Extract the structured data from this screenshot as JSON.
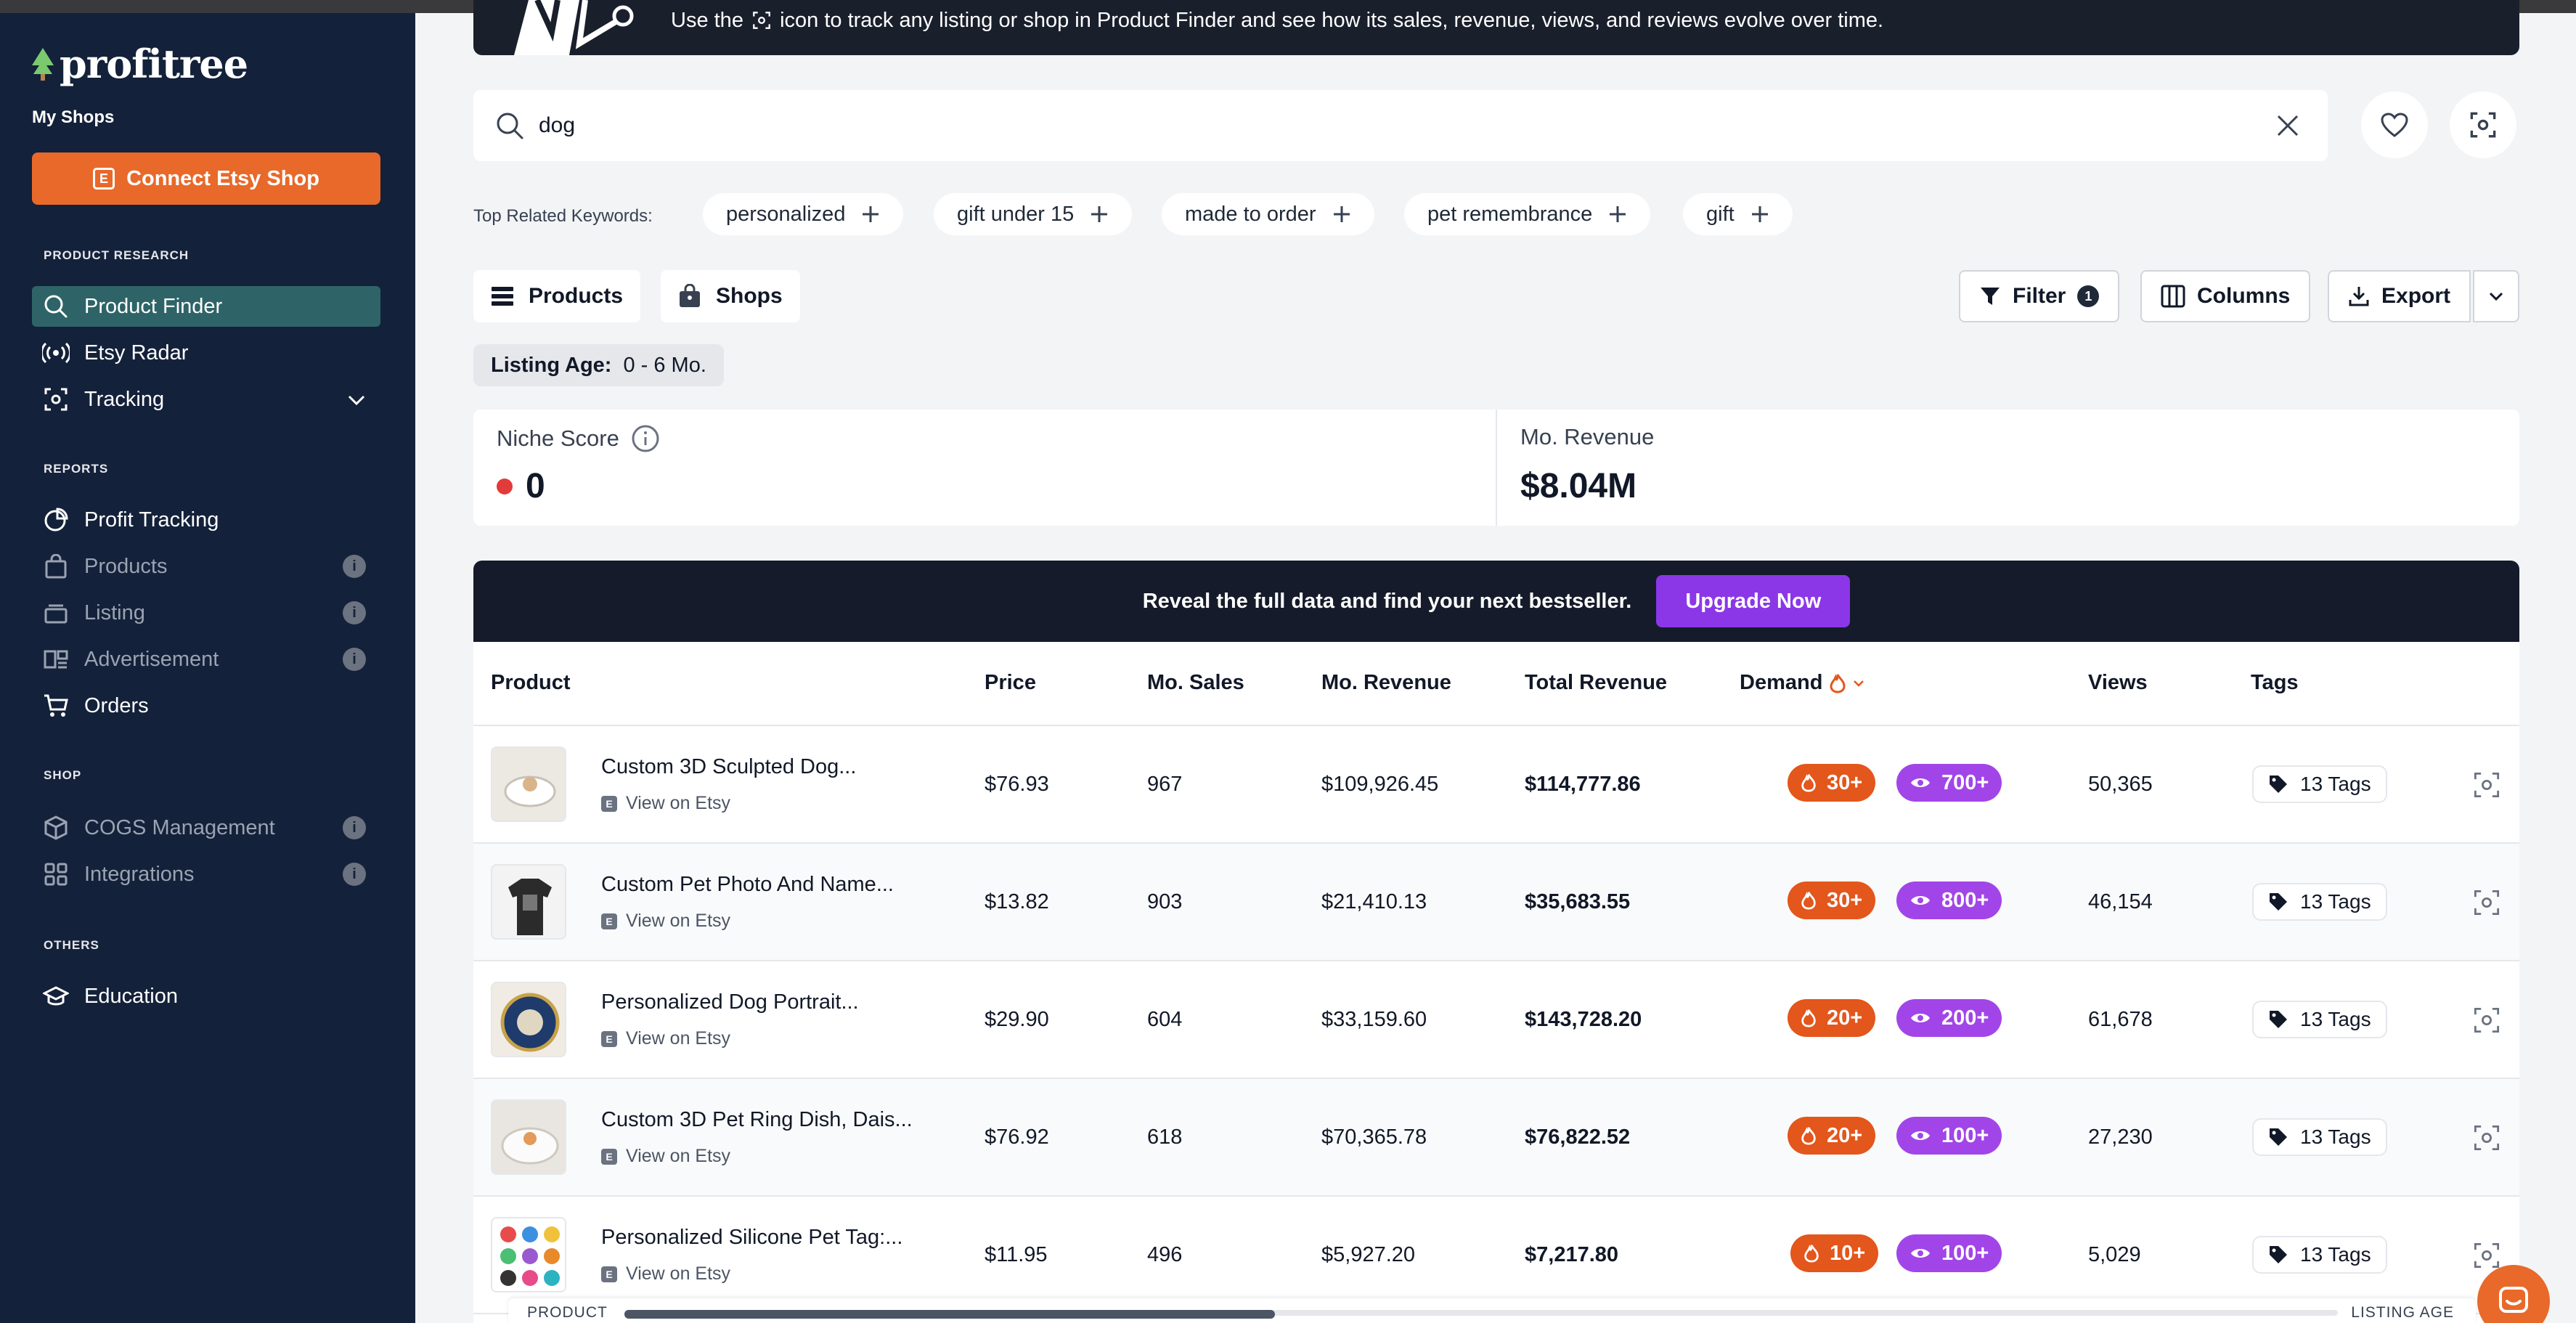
{
  "sidebar": {
    "logo": "profitree",
    "my_shops": "My Shops",
    "connect_button": "Connect Etsy Shop",
    "sections": {
      "product_research": "PRODUCT RESEARCH",
      "reports": "REPORTS",
      "shop": "SHOP",
      "others": "OTHERS"
    },
    "items": {
      "product_finder": "Product Finder",
      "etsy_radar": "Etsy Radar",
      "tracking": "Tracking",
      "profit_tracking": "Profit Tracking",
      "products": "Products",
      "listing": "Listing",
      "advertisement": "Advertisement",
      "orders": "Orders",
      "cogs": "COGS Management",
      "integrations": "Integrations",
      "education": "Education"
    }
  },
  "banner": {
    "text_before": "Use the",
    "text_after": "icon to track any listing or shop in Product Finder and see how its sales, revenue, views, and reviews evolve over time."
  },
  "search": {
    "value": "dog"
  },
  "keywords": {
    "label": "Top Related Keywords:",
    "chips": [
      "personalized",
      "gift under 15",
      "made to order",
      "pet remembrance",
      "gift"
    ]
  },
  "tabs": {
    "products": "Products",
    "shops": "Shops"
  },
  "toolbar": {
    "filter": "Filter",
    "filter_count": "1",
    "columns": "Columns",
    "export": "Export"
  },
  "listing_age": {
    "label": "Listing Age:",
    "value": "0 - 6 Mo."
  },
  "stats": {
    "niche_label": "Niche Score",
    "niche_value": "0",
    "revenue_label": "Mo. Revenue",
    "revenue_value": "$8.04M"
  },
  "upgrade": {
    "text": "Reveal the full data and find your next bestseller.",
    "button": "Upgrade Now"
  },
  "table": {
    "columns": {
      "product": "Product",
      "price": "Price",
      "sales": "Mo. Sales",
      "revenue": "Mo. Revenue",
      "total": "Total Revenue",
      "demand": "Demand",
      "views": "Views",
      "tags": "Tags"
    },
    "view_on_etsy": "View on Etsy",
    "rows": [
      {
        "name": "Custom 3D Sculpted Dog...",
        "price": "$76.93",
        "sales": "967",
        "revenue": "$109,926.45",
        "total": "$114,777.86",
        "fire": "30+",
        "eye": "700+",
        "views": "50,365",
        "tags": "13 Tags"
      },
      {
        "name": "Custom Pet Photo And Name...",
        "price": "$13.82",
        "sales": "903",
        "revenue": "$21,410.13",
        "total": "$35,683.55",
        "fire": "30+",
        "eye": "800+",
        "views": "46,154",
        "tags": "13 Tags"
      },
      {
        "name": "Personalized Dog Portrait...",
        "price": "$29.90",
        "sales": "604",
        "revenue": "$33,159.60",
        "total": "$143,728.20",
        "fire": "20+",
        "eye": "200+",
        "views": "61,678",
        "tags": "13 Tags"
      },
      {
        "name": "Custom 3D Pet Ring Dish, Dais...",
        "price": "$76.92",
        "sales": "618",
        "revenue": "$70,365.78",
        "total": "$76,822.52",
        "fire": "20+",
        "eye": "100+",
        "views": "27,230",
        "tags": "13 Tags"
      },
      {
        "name": "Personalized Silicone Pet Tag:...",
        "price": "$11.95",
        "sales": "496",
        "revenue": "$5,927.20",
        "total": "$7,217.80",
        "fire": "10+",
        "eye": "100+",
        "views": "5,029",
        "tags": "13 Tags"
      }
    ]
  },
  "scroll": {
    "left_label": "PRODUCT",
    "right_label": "LISTING AGE",
    "position": 0.38
  },
  "colors": {
    "sidebar": "#14213a",
    "accent": "#e8692a",
    "upgrade": "#8b37e8",
    "active_nav": "#2e6468"
  }
}
